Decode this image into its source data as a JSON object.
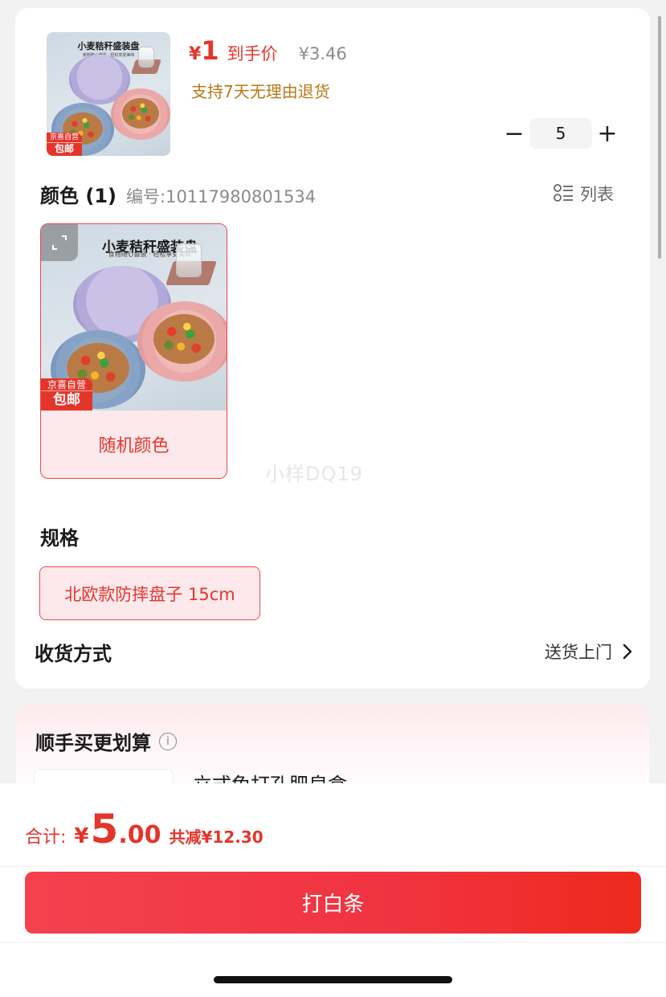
{
  "product": {
    "thumb_banner": "小麦秸秆盛装盘",
    "thumb_sub": "食物随心盛装 · 轻松享受美味",
    "badge_top": "京喜自营",
    "badge_bottom": "包邮",
    "price_symbol": "¥",
    "price_value": "1",
    "price_label": "到手价",
    "original_price": "¥3.46",
    "return_policy": "支持7天无理由退货"
  },
  "quantity": {
    "minus_label": "−",
    "value": "5",
    "plus_label": "+"
  },
  "color_section": {
    "title": "颜色 (1)",
    "code_label": "编号:",
    "code": "10117980801534",
    "list_toggle_label": "列表",
    "options": [
      {
        "image_banner": "小麦秸秆盛装盘",
        "image_sub": "食物随心盛装 · 轻松享受美味",
        "badge_top": "京喜自营",
        "badge_bottom": "包邮",
        "label": "随机颜色",
        "selected": true
      }
    ]
  },
  "watermark": "小样DQ19",
  "spec_section": {
    "title": "规格",
    "options": [
      {
        "label": "北欧款防摔盘子 15cm",
        "selected": true
      }
    ]
  },
  "delivery": {
    "label": "收货方式",
    "value": "送货上门"
  },
  "upsell": {
    "title": "顺手买更划算",
    "info_icon": "i",
    "item_name": "立式免打孔肥皂盒"
  },
  "footer": {
    "total_label": "合计:",
    "total_symbol": "¥",
    "total_int": "5",
    "total_dec": ".00",
    "total_savings": "共减¥12.30",
    "pay_button_label": "打白条"
  },
  "colors": {
    "accent": "#e4352b",
    "return_tag": "#b8781a",
    "selected_bg": "#fde9ec",
    "selected_border": "#f04747"
  }
}
